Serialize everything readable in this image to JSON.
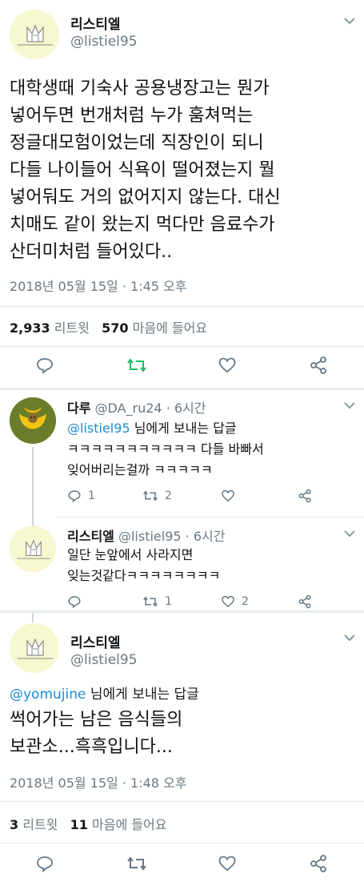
{
  "main_tweet": {
    "author_name": "리스티엘",
    "author_handle": "@listiel95",
    "body_lines": [
      "대학생때 기숙사 공용냉장고는 뭔가",
      "넣어두면 번개처럼 누가 훔쳐먹는",
      "정글대모험이었는데 직장인이 되니",
      "다들 나이들어 식욕이 떨어졌는지 뭘",
      "넣어둬도 거의 없어지지 않는다. 대신",
      "치매도 같이 왔는지 먹다만 음료수가",
      "산더미처럼 들어있다.."
    ],
    "timestamp": "2018년 05월 15일 · 1:45 오후",
    "retweet_count": "2,933",
    "retweet_label": "리트윗",
    "like_count": "570",
    "like_label": "마음에 들어요"
  },
  "reply1": {
    "author_name": "다루",
    "author_handle": "@DA_ru24",
    "time": "· 6시간",
    "reply_to_handle": "@listiel95",
    "reply_to_suffix": "님에게 보내는 답글",
    "body_lines": [
      "ㅋㅋㅋㅋㅋㅋㅋㅋㅋㅋㅋ 다들 바빠서",
      "잊어버리는걸까 ㅋㅋㅋㅋㅋ"
    ],
    "reply_count": "1",
    "retweet_count": "2"
  },
  "reply2": {
    "author_name": "리스티엘",
    "author_handle": "@listiel95",
    "time": "· 6시간",
    "body_lines": [
      "일단 눈앞에서 사라지면",
      "잊는것같다ㅋㅋㅋㅋㅋㅋㅋㅋ"
    ],
    "retweet_count": "1",
    "like_count": "2"
  },
  "third_tweet": {
    "author_name": "리스티엘",
    "author_handle": "@listiel95",
    "reply_to_handle": "@yomujine",
    "reply_to_suffix": "님에게 보내는 답글",
    "body_lines": [
      "썩어가는 남은 음식들의",
      "보관소...흑흑입니다..."
    ],
    "timestamp": "2018년 05월 15일 · 1:48 오후",
    "retweet_count": "3",
    "retweet_label": "리트윗",
    "like_count": "11",
    "like_label": "마음에 들어요"
  },
  "colors": {
    "accent": "#1b8cd6",
    "retweet_active": "#17bf63",
    "muted": "#6b7883"
  },
  "icons": [
    "chevron-down-icon",
    "reply-icon",
    "retweet-icon",
    "like-icon",
    "share-icon"
  ]
}
